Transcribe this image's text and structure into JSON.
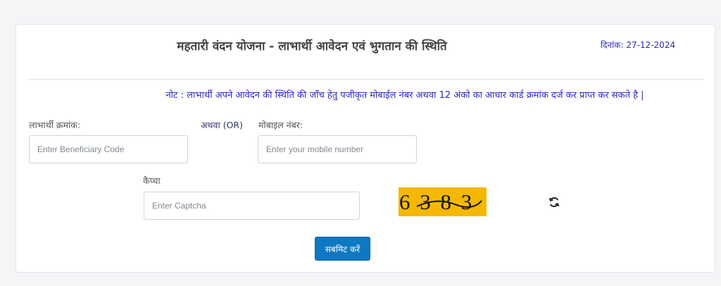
{
  "header": {
    "title": "महतारी वंदन योजना - लाभार्थी आवेदन एवं भुगतान की स्थिति",
    "date_label": "दिनांक:",
    "date_value": "27-12-2024"
  },
  "note": "नोट : लाभार्थी अपने आवेदन की स्थिति की जाँच हेतु पजीकृत मोबाईल नंबर अथवा 12 अंको का आधार कार्ड क्रमांक दर्ज कर प्राप्त कर सकते है |",
  "form": {
    "beneficiary_label": "लाभार्थी क्रमांक:",
    "beneficiary_placeholder": "Enter Beneficiary Code",
    "or_label": "अथवा (OR)",
    "mobile_label": "मोबाइल नंबर:",
    "mobile_placeholder": "Enter your mobile number",
    "captcha_label": "कैप्चा",
    "captcha_placeholder": "Enter Captcha",
    "captcha_text": "6 3 8 3",
    "submit_label": "सबमिट करें"
  },
  "colors": {
    "accent_text": "#2a2ac0",
    "button": "#0e78c3",
    "captcha_bg": "#f5b800"
  },
  "icons": {
    "refresh": "refresh-icon"
  }
}
